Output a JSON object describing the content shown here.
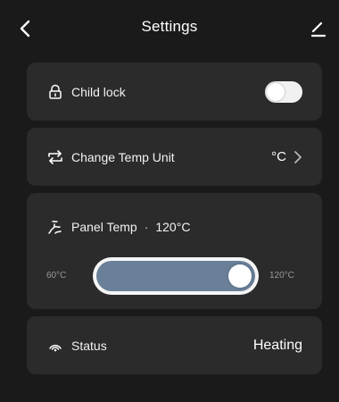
{
  "header": {
    "title": "Settings",
    "back_icon": "chevron-left-icon",
    "edit_icon": "pencil-icon"
  },
  "child_lock": {
    "label": "Child lock",
    "icon": "lock-icon",
    "enabled": false
  },
  "temp_unit": {
    "label": "Change Temp Unit",
    "icon": "swap-icon",
    "value": "°C",
    "chevron": "chevron-right-icon"
  },
  "panel_temp": {
    "label": "Panel Temp",
    "separator": "·",
    "value": "120°C",
    "icon": "heat-waves-icon",
    "range_min": "60°C",
    "range_max": "120°C",
    "slider_level": 1.0
  },
  "status": {
    "label": "Status",
    "icon": "signal-icon",
    "value": "Heating"
  },
  "colors": {
    "background": "#1a1a1a",
    "card": "#2b2b2b",
    "slider_fill": "#6a8099",
    "text": "#ffffff",
    "muted_text": "#9a9a9a"
  }
}
